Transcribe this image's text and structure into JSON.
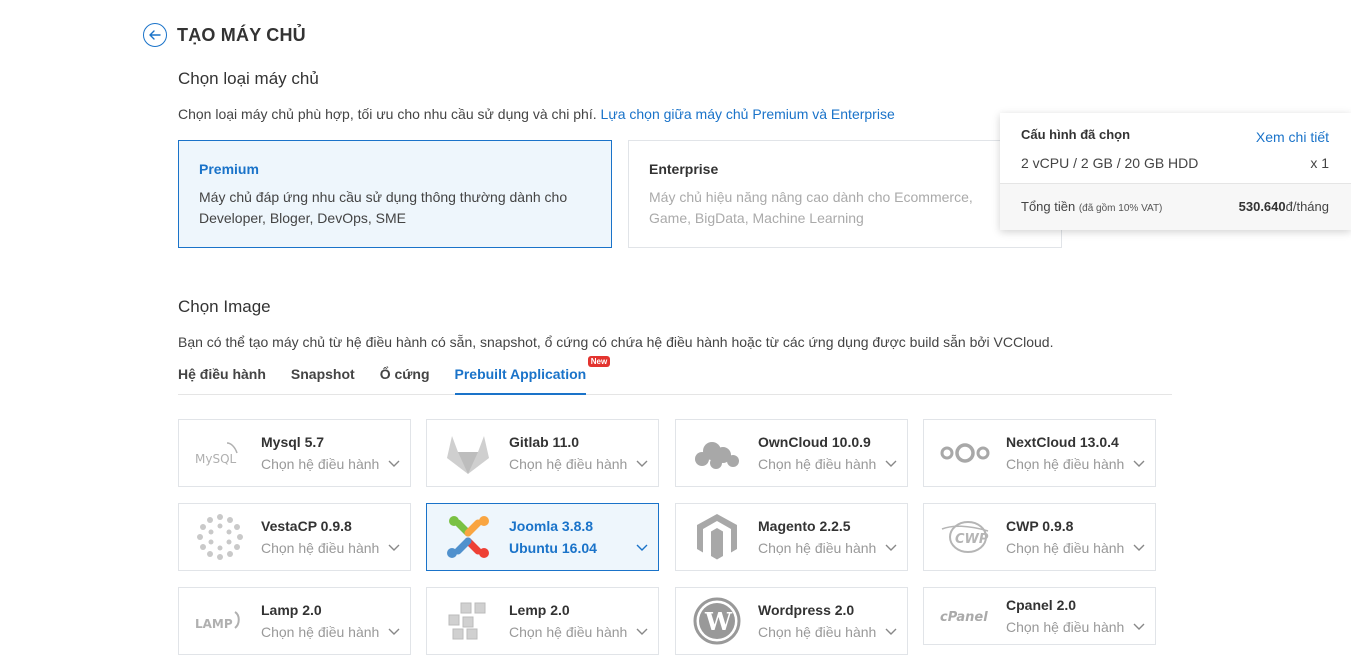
{
  "header": {
    "title": "TẠO MÁY CHỦ"
  },
  "server_type": {
    "title": "Chọn loại máy chủ",
    "desc": "Chọn loại máy chủ phù hợp, tối ưu cho nhu cầu sử dụng và chi phí.",
    "link": "Lựa chọn giữa máy chủ Premium và Enterprise",
    "premium": {
      "name": "Premium",
      "desc": "Máy chủ đáp ứng nhu cầu sử dụng thông thường dành cho Developer, Bloger, DevOps, SME"
    },
    "enterprise": {
      "name": "Enterprise",
      "desc": "Máy chủ hiệu năng nâng cao dành cho Ecommerce, Game, BigData, Machine Learning"
    }
  },
  "image": {
    "title": "Chọn Image",
    "desc": "Bạn có thể tạo máy chủ từ hệ điều hành có sẵn, snapshot, ổ cứng có chứa hệ điều hành hoặc từ các ứng dụng được build sẵn bởi VCCloud.",
    "tabs": [
      {
        "label": "Hệ điều hành"
      },
      {
        "label": "Snapshot"
      },
      {
        "label": "Ổ cứng"
      },
      {
        "label": "Prebuilt Application",
        "badge": "New"
      }
    ]
  },
  "apps": [
    {
      "name": "Mysql 5.7",
      "os": "Chọn hệ điều hành",
      "icon": "mysql-logo"
    },
    {
      "name": "Gitlab 11.0",
      "os": "Chọn hệ điều hành",
      "icon": "gitlab-logo"
    },
    {
      "name": "OwnCloud 10.0.9",
      "os": "Chọn hệ điều hành",
      "icon": "owncloud-logo"
    },
    {
      "name": "NextCloud 13.0.4",
      "os": "Chọn hệ điều hành",
      "icon": "nextcloud-logo"
    },
    {
      "name": "VestaCP 0.9.8",
      "os": "Chọn hệ điều hành",
      "icon": "vestacp-logo"
    },
    {
      "name": "Joomla 3.8.8",
      "os": "Ubuntu 16.04",
      "icon": "joomla-logo"
    },
    {
      "name": "Magento 2.2.5",
      "os": "Chọn hệ điều hành",
      "icon": "magento-logo"
    },
    {
      "name": "CWP 0.9.8",
      "os": "Chọn hệ điều hành",
      "icon": "cwp-logo"
    },
    {
      "name": "Lamp 2.0",
      "os": "Chọn hệ điều hành",
      "icon": "lamp-logo"
    },
    {
      "name": "Lemp 2.0",
      "os": "Chọn hệ điều hành",
      "icon": "lemp-logo"
    },
    {
      "name": "Wordpress 2.0",
      "os": "Chọn hệ điều hành",
      "icon": "wordpress-logo"
    },
    {
      "name": "Cpanel 2.0",
      "os": "Chọn hệ điều hành",
      "icon": "cpanel-logo"
    }
  ],
  "summary": {
    "title": "Cấu hình đã chọn",
    "link": "Xem chi tiết",
    "config": "2 vCPU / 2 GB / 20 GB HDD",
    "qty": "x 1",
    "total_label": "Tổng tiền",
    "vat_note": "(đã gồm 10% VAT)",
    "price": "530.640",
    "price_unit": "đ/tháng"
  },
  "colors": {
    "accent": "#1a73c9",
    "badge": "#e3342f"
  }
}
